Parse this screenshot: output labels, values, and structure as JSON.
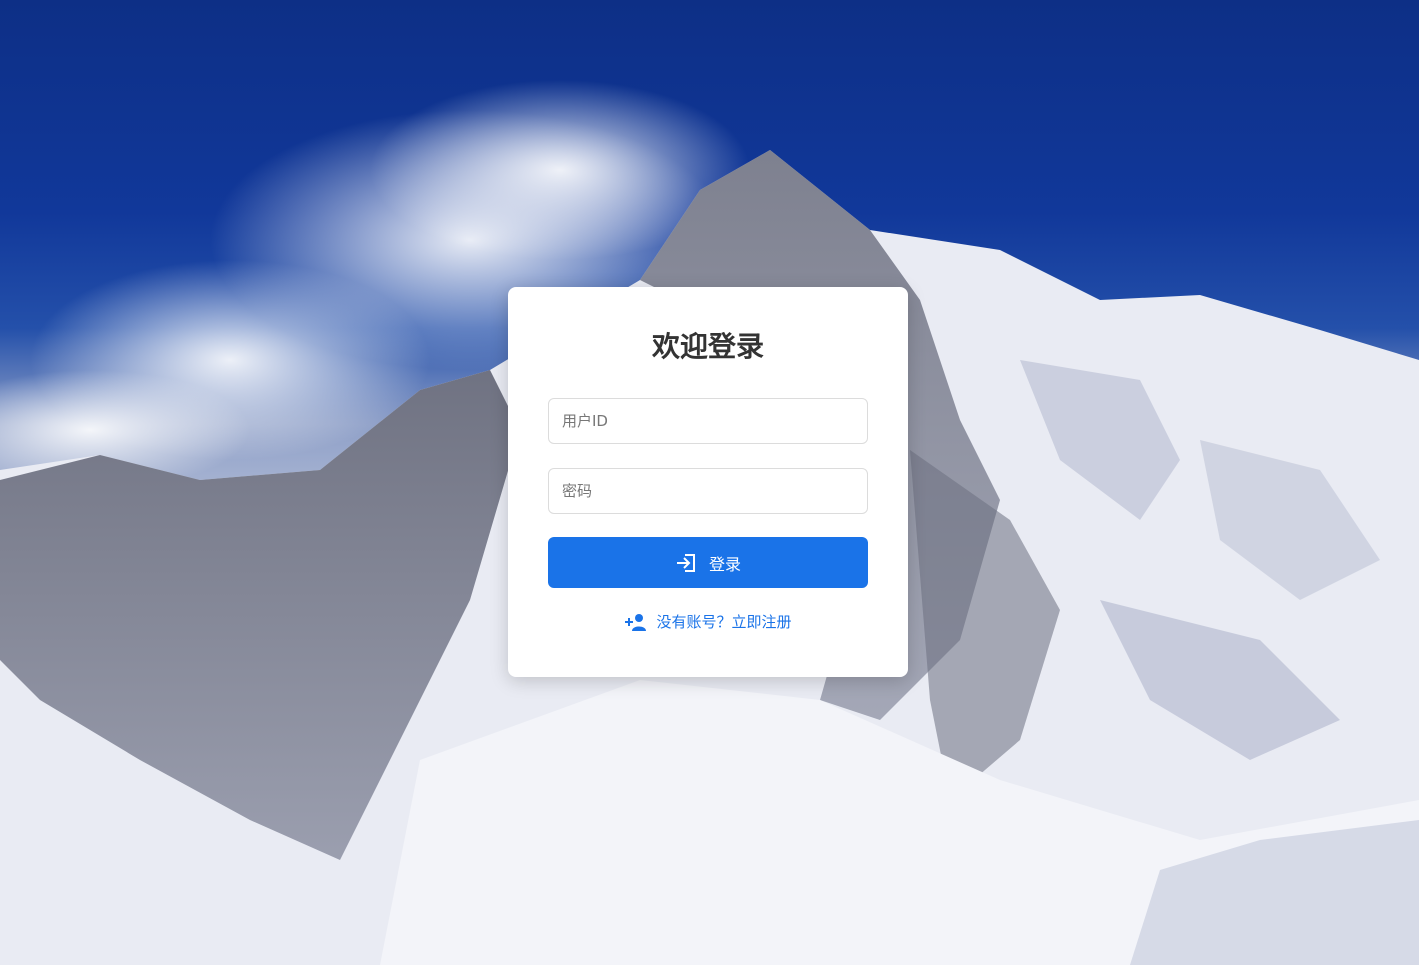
{
  "login": {
    "title": "欢迎登录",
    "user_id_placeholder": "用户ID",
    "password_placeholder": "密码",
    "submit_label": "登录",
    "register_link": "没有账号？立即注册"
  },
  "icons": {
    "submit": "login-arrow-icon",
    "register": "person-add-icon"
  },
  "colors": {
    "accent": "#1a73e8",
    "title": "#333333",
    "sky": "#0d2f86"
  }
}
